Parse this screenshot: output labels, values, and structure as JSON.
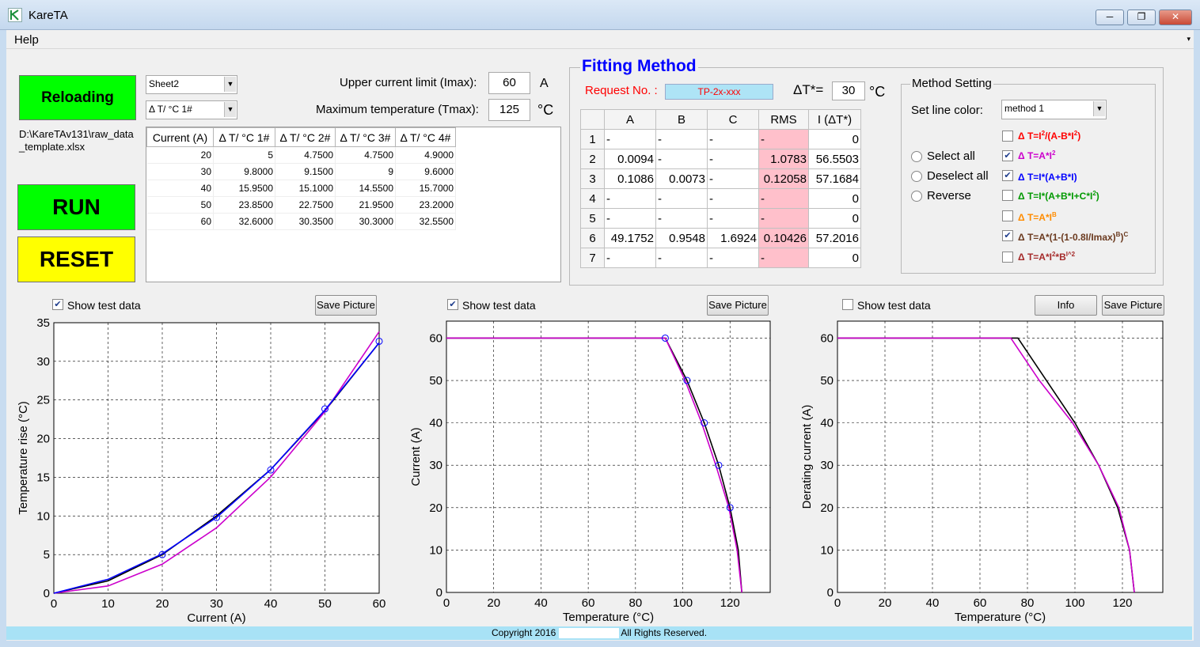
{
  "window": {
    "title": "KareTA",
    "minimize": "─",
    "maximize": "❐",
    "close": "✕"
  },
  "menu": {
    "help": "Help",
    "arrow": "▾"
  },
  "buttons": {
    "reloading": "Reloading",
    "run": "RUN",
    "reset": "RESET"
  },
  "file_path": "D:\\KareTAv131\\raw_data_template.xlsx",
  "sheet_combo": "Sheet2",
  "column_combo": "Δ T/ °C 1#",
  "limits": {
    "imax_label": "Upper current limit (Imax):",
    "imax_value": "60",
    "imax_unit": "A",
    "tmax_label": "Maximum temperature (Tmax):",
    "tmax_value": "125",
    "tmax_unit": "°C"
  },
  "data_table": {
    "headers": [
      "Current (A)",
      "Δ T/ °C 1#",
      "Δ T/ °C 2#",
      "Δ T/ °C 3#",
      "Δ T/ °C 4#"
    ],
    "rows": [
      [
        "20",
        "5",
        "4.7500",
        "4.7500",
        "4.9000"
      ],
      [
        "30",
        "9.8000",
        "9.1500",
        "9",
        "9.6000"
      ],
      [
        "40",
        "15.9500",
        "15.1000",
        "14.5500",
        "15.7000"
      ],
      [
        "50",
        "23.8500",
        "22.7500",
        "21.9500",
        "23.2000"
      ],
      [
        "60",
        "32.6000",
        "30.3500",
        "30.3000",
        "32.5500"
      ]
    ]
  },
  "fitting": {
    "title": "Fitting Method",
    "request_label": "Request No. :",
    "request_value": "TP-2x-xxx",
    "dt_label": "ΔT*=",
    "dt_value": "30",
    "dt_unit": "°C",
    "headers": [
      "",
      "A",
      "B",
      "C",
      "RMS",
      "I (ΔT*)"
    ],
    "rows": [
      [
        "1",
        "-",
        "-",
        "-",
        "-",
        "0"
      ],
      [
        "2",
        "0.0094",
        "-",
        "-",
        "1.0783",
        "56.5503"
      ],
      [
        "3",
        "0.1086",
        "0.0073",
        "-",
        "0.12058",
        "57.1684"
      ],
      [
        "4",
        "-",
        "-",
        "-",
        "-",
        "0"
      ],
      [
        "5",
        "-",
        "-",
        "-",
        "-",
        "0"
      ],
      [
        "6",
        "49.1752",
        "0.9548",
        "1.6924",
        "0.10426",
        "57.2016"
      ],
      [
        "7",
        "-",
        "-",
        "-",
        "-",
        "0"
      ]
    ]
  },
  "method_setting": {
    "title": "Method Setting",
    "line_color_label": "Set line color:",
    "line_color_value": "method 1",
    "select_all": "Select all",
    "deselect_all": "Deselect all",
    "reverse": "Reverse",
    "formulas": [
      {
        "checked": false,
        "color": "#ff0000"
      },
      {
        "checked": true,
        "color": "#cc00cc"
      },
      {
        "checked": true,
        "color": "#0000ff"
      },
      {
        "checked": false,
        "color": "#009900"
      },
      {
        "checked": false,
        "color": "#ff8c00"
      },
      {
        "checked": true,
        "color": "#6b3a1f"
      },
      {
        "checked": false,
        "color": "#a52a2a"
      }
    ]
  },
  "plots": {
    "show_test_data": "Show test data",
    "save_picture": "Save Picture",
    "info": "Info",
    "plot1": {
      "checked": true,
      "xlabel": "Current (A)",
      "ylabel": "Temperature rise (°C)",
      "xticks": [
        "0",
        "10",
        "20",
        "30",
        "40",
        "50",
        "60"
      ],
      "yticks": [
        "0",
        "5",
        "10",
        "15",
        "20",
        "25",
        "30",
        "35"
      ]
    },
    "plot2": {
      "checked": true,
      "xlabel": "Temperature (°C)",
      "ylabel": "Current (A)",
      "xticks": [
        "0",
        "20",
        "40",
        "60",
        "80",
        "100",
        "120"
      ],
      "yticks": [
        "0",
        "10",
        "20",
        "30",
        "40",
        "50",
        "60"
      ]
    },
    "plot3": {
      "checked": false,
      "xlabel": "Temperature (°C)",
      "ylabel": "Derating current (A)",
      "xticks": [
        "0",
        "20",
        "40",
        "60",
        "80",
        "100",
        "120"
      ],
      "yticks": [
        "0",
        "10",
        "20",
        "30",
        "40",
        "50",
        "60"
      ]
    }
  },
  "chart_data": [
    {
      "type": "line",
      "xlabel": "Current (A)",
      "ylabel": "Temperature rise (°C)",
      "xlim": [
        0,
        60
      ],
      "ylim": [
        0,
        35
      ],
      "grid": true,
      "series": [
        {
          "color": "#000000",
          "x": [
            0,
            10,
            20,
            30,
            40,
            50,
            60
          ],
          "y": [
            0,
            1.6,
            5.0,
            10.0,
            16.0,
            23.6,
            32.4
          ]
        },
        {
          "color": "#cc00cc",
          "x": [
            0,
            10,
            20,
            30,
            40,
            50,
            60
          ],
          "y": [
            0,
            0.94,
            3.76,
            8.46,
            15.04,
            23.5,
            33.84
          ]
        },
        {
          "color": "#0000ff",
          "x": [
            0,
            10,
            20,
            30,
            40,
            50,
            60
          ],
          "y": [
            0,
            1.8,
            5.1,
            9.8,
            16.0,
            23.7,
            32.4
          ]
        }
      ],
      "markers": {
        "x": [
          20,
          30,
          40,
          50,
          60
        ],
        "y": [
          5,
          9.8,
          15.95,
          23.85,
          32.6
        ]
      }
    },
    {
      "type": "line",
      "xlabel": "Temperature (°C)",
      "ylabel": "Current (A)",
      "xlim": [
        0,
        137
      ],
      "ylim": [
        0,
        64
      ],
      "grid": true,
      "series": [
        {
          "color": "#000000",
          "x": [
            0,
            92.6,
            101.8,
            109.1,
            115.2,
            120,
            123.5,
            125
          ],
          "y": [
            60,
            60,
            50,
            40,
            30,
            20,
            10,
            0
          ]
        },
        {
          "color": "#cc00cc",
          "x": [
            0,
            92.6,
            101,
            108,
            114,
            119.5,
            123,
            125
          ],
          "y": [
            60,
            60,
            50,
            40,
            30,
            20,
            10,
            0
          ]
        }
      ],
      "markers": {
        "x": [
          92.6,
          101.8,
          109.1,
          115.2,
          120
        ],
        "y": [
          60,
          50,
          40,
          30,
          20
        ]
      }
    },
    {
      "type": "line",
      "xlabel": "Temperature (°C)",
      "ylabel": "Derating current (A)",
      "xlim": [
        0,
        137
      ],
      "ylim": [
        0,
        64
      ],
      "grid": true,
      "series": [
        {
          "color": "#000000",
          "x": [
            0,
            76,
            88,
            100,
            110,
            118,
            123,
            125
          ],
          "y": [
            60,
            60,
            50,
            40,
            30,
            20,
            10,
            0
          ]
        },
        {
          "color": "#cc00cc",
          "x": [
            0,
            73,
            85,
            99,
            110,
            118.5,
            123,
            125
          ],
          "y": [
            60,
            60,
            50,
            40,
            30,
            20,
            10,
            0
          ]
        }
      ]
    }
  ],
  "footer": {
    "copyright_pre": "Copyright 2016",
    "copyright_post": "All Rights Reserved."
  }
}
